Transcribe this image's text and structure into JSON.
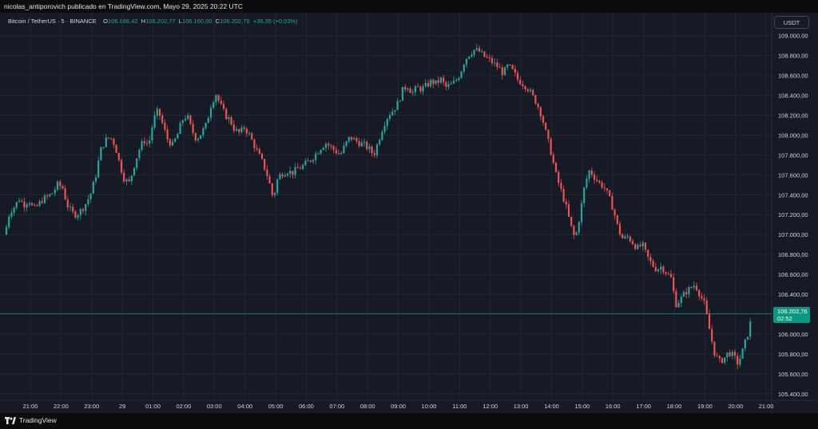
{
  "header": {
    "publisher_line": "nicolas_antiporovich publicado en TradingView.com, Mayo 29, 2025 20:22 UTC"
  },
  "legend": {
    "symbol": "Bitcoin / TetherUS · 5 · BINANCE",
    "open_label": "O",
    "open": "106.166,42",
    "high_label": "H",
    "high": "106.202,77",
    "low_label": "L",
    "low": "106.160,00",
    "close_label": "C",
    "close": "106.202,76",
    "change": "+36,35 (+0,03%)"
  },
  "currency_button": "USDT",
  "price_tag": {
    "price": "106.202,76",
    "countdown": "02:52"
  },
  "footer": {
    "brand": "TradingView"
  },
  "colors": {
    "up": "#26a69a",
    "down": "#ef5350",
    "background": "#161a25",
    "grid": "#232734",
    "price_line": "#089981"
  },
  "chart_data": {
    "type": "candlestick",
    "y_axis_labels": [
      "109.000,00",
      "108.800,00",
      "108.600,00",
      "108.400,00",
      "108.200,00",
      "108.000,00",
      "107.800,00",
      "107.600,00",
      "107.400,00",
      "107.200,00",
      "107.000,00",
      "106.800,00",
      "106.600,00",
      "106.400,00",
      "106.000,00",
      "105.800,00",
      "105.600,00",
      "105.400,00"
    ],
    "x_axis_labels": [
      "21:00",
      "22:00",
      "23:00",
      "29",
      "01:00",
      "02:00",
      "03:00",
      "04:00",
      "05:00",
      "06:00",
      "07:00",
      "08:00",
      "09:00",
      "10:00",
      "11:00",
      "12:00",
      "13:00",
      "14:00",
      "15:00",
      "16:00",
      "17:00",
      "18:00",
      "19:00",
      "20:00",
      "21:00"
    ],
    "ylim": [
      105350,
      109150
    ],
    "current_price": 106202.76,
    "path_points": [
      [
        0,
        107000
      ],
      [
        6,
        107230
      ],
      [
        12,
        107280
      ],
      [
        18,
        107360
      ],
      [
        24,
        107300
      ],
      [
        30,
        107350
      ],
      [
        36,
        107250
      ],
      [
        42,
        107300
      ],
      [
        48,
        107360
      ],
      [
        54,
        107380
      ],
      [
        60,
        107420
      ],
      [
        66,
        107500
      ],
      [
        72,
        107480
      ],
      [
        78,
        107300
      ],
      [
        84,
        107220
      ],
      [
        90,
        107200
      ],
      [
        96,
        107250
      ],
      [
        102,
        107320
      ],
      [
        108,
        107420
      ],
      [
        114,
        107600
      ],
      [
        120,
        107850
      ],
      [
        126,
        107950
      ],
      [
        132,
        107980
      ],
      [
        138,
        107900
      ],
      [
        144,
        107700
      ],
      [
        150,
        107550
      ],
      [
        156,
        107520
      ],
      [
        162,
        107700
      ],
      [
        168,
        107850
      ],
      [
        174,
        107950
      ],
      [
        180,
        107900
      ],
      [
        186,
        108150
      ],
      [
        192,
        108250
      ],
      [
        198,
        108100
      ],
      [
        204,
        107950
      ],
      [
        210,
        107900
      ],
      [
        216,
        108000
      ],
      [
        222,
        108150
      ],
      [
        228,
        108200
      ],
      [
        234,
        108050
      ],
      [
        240,
        107960
      ],
      [
        246,
        108020
      ],
      [
        252,
        108100
      ],
      [
        258,
        108300
      ],
      [
        264,
        108420
      ],
      [
        270,
        108300
      ],
      [
        276,
        108200
      ],
      [
        282,
        108150
      ],
      [
        288,
        108050
      ],
      [
        294,
        108020
      ],
      [
        300,
        108080
      ],
      [
        306,
        108000
      ],
      [
        312,
        107900
      ],
      [
        318,
        107800
      ],
      [
        324,
        107700
      ],
      [
        330,
        107560
      ],
      [
        336,
        107360
      ],
      [
        342,
        107580
      ],
      [
        348,
        107620
      ],
      [
        354,
        107640
      ],
      [
        360,
        107620
      ],
      [
        366,
        107660
      ],
      [
        372,
        107680
      ],
      [
        378,
        107720
      ],
      [
        384,
        107760
      ],
      [
        390,
        107820
      ],
      [
        396,
        107880
      ],
      [
        402,
        107920
      ],
      [
        408,
        107880
      ],
      [
        414,
        107840
      ],
      [
        420,
        107800
      ],
      [
        426,
        107900
      ],
      [
        432,
        107980
      ],
      [
        438,
        107950
      ],
      [
        444,
        107920
      ],
      [
        450,
        107900
      ],
      [
        456,
        107860
      ],
      [
        462,
        107800
      ],
      [
        468,
        107950
      ],
      [
        474,
        108100
      ],
      [
        480,
        108200
      ],
      [
        486,
        108250
      ],
      [
        492,
        108320
      ],
      [
        498,
        108450
      ],
      [
        504,
        108500
      ],
      [
        510,
        108420
      ],
      [
        516,
        108480
      ],
      [
        522,
        108460
      ],
      [
        528,
        108500
      ],
      [
        534,
        108540
      ],
      [
        540,
        108520
      ],
      [
        546,
        108560
      ],
      [
        552,
        108480
      ],
      [
        558,
        108500
      ],
      [
        564,
        108540
      ],
      [
        570,
        108620
      ],
      [
        576,
        108760
      ],
      [
        582,
        108820
      ],
      [
        588,
        108860
      ],
      [
        594,
        108840
      ],
      [
        600,
        108790
      ],
      [
        606,
        108760
      ],
      [
        612,
        108720
      ],
      [
        618,
        108680
      ],
      [
        624,
        108620
      ],
      [
        630,
        108700
      ],
      [
        636,
        108640
      ],
      [
        642,
        108560
      ],
      [
        648,
        108520
      ],
      [
        654,
        108480
      ],
      [
        660,
        108400
      ],
      [
        666,
        108320
      ],
      [
        672,
        108200
      ],
      [
        678,
        108000
      ],
      [
        684,
        107820
      ],
      [
        690,
        107600
      ],
      [
        696,
        107450
      ],
      [
        702,
        107300
      ],
      [
        708,
        107100
      ],
      [
        714,
        106950
      ],
      [
        720,
        107200
      ],
      [
        726,
        107500
      ],
      [
        732,
        107650
      ],
      [
        738,
        107580
      ],
      [
        744,
        107520
      ],
      [
        750,
        107480
      ],
      [
        756,
        107380
      ],
      [
        762,
        107250
      ],
      [
        768,
        107050
      ],
      [
        774,
        106950
      ],
      [
        780,
        106980
      ],
      [
        786,
        106920
      ],
      [
        792,
        106860
      ],
      [
        798,
        106900
      ],
      [
        804,
        106780
      ],
      [
        810,
        106700
      ],
      [
        816,
        106650
      ],
      [
        822,
        106680
      ],
      [
        828,
        106620
      ],
      [
        834,
        106560
      ],
      [
        840,
        106300
      ],
      [
        846,
        106350
      ],
      [
        852,
        106420
      ],
      [
        858,
        106460
      ],
      [
        864,
        106500
      ],
      [
        870,
        106400
      ],
      [
        876,
        106300
      ],
      [
        882,
        106050
      ],
      [
        888,
        105820
      ],
      [
        894,
        105720
      ],
      [
        900,
        105750
      ],
      [
        906,
        105820
      ],
      [
        912,
        105780
      ],
      [
        918,
        105700
      ],
      [
        924,
        105840
      ],
      [
        930,
        106000
      ],
      [
        936,
        106202.76
      ]
    ]
  }
}
